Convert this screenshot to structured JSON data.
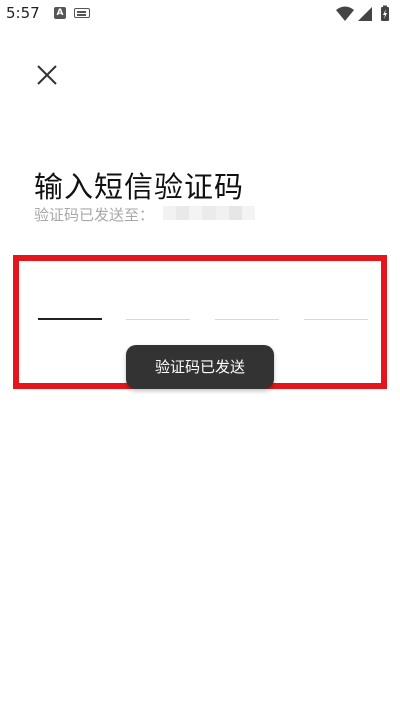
{
  "status_bar": {
    "time": "5:57",
    "app_notification_letter": "A",
    "icons": [
      "a-notification-icon",
      "keyboard-icon",
      "wifi-icon",
      "cell-signal-icon",
      "battery-charging-icon"
    ]
  },
  "header": {
    "close_icon": "close-icon"
  },
  "main": {
    "title": "输入短信验证码",
    "subtitle": "验证码已发送至：",
    "code_slots": [
      {
        "value": "",
        "active": true
      },
      {
        "value": "",
        "active": false
      },
      {
        "value": "",
        "active": false
      },
      {
        "value": "",
        "active": false
      }
    ]
  },
  "toast": {
    "text": "验证码已发送"
  },
  "colors": {
    "highlight": "#e5161b",
    "toast_bg": "#333333",
    "subtitle_text": "#a8a8a8",
    "active_underline": "#222222",
    "inactive_underline": "#d8d8d8"
  }
}
